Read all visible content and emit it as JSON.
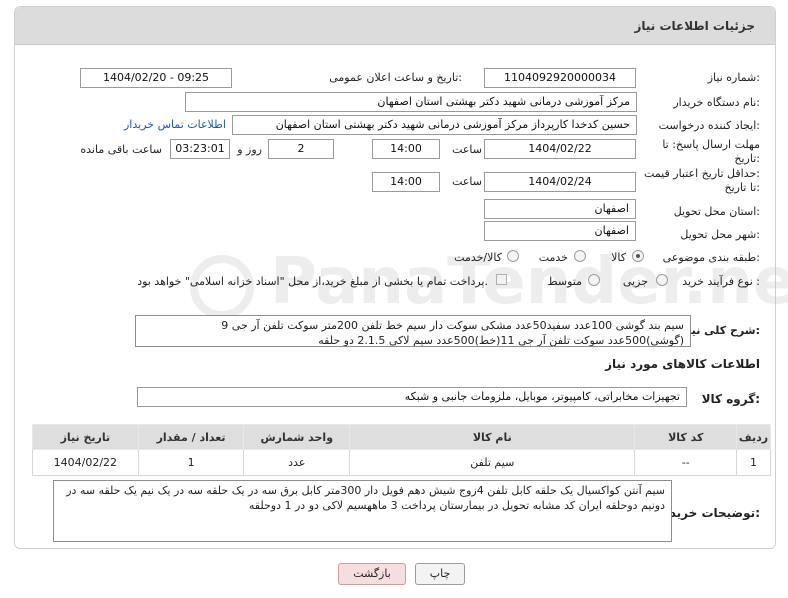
{
  "panel": {
    "title": "جزئیات اطلاعات نیاز"
  },
  "watermark": {
    "text": "PanaTender.net"
  },
  "need": {
    "number_label": "شماره نیاز:",
    "number": "1104092920000034",
    "announce_label": "تاریخ و ساعت اعلان عمومی:",
    "announce": "1404/02/20 - 09:25",
    "buyer_label": "نام دستگاه خریدار:",
    "buyer": "مرکز آموزشی درمانی شهید دکتر بهشتی استان اصفهان",
    "creator_label": "ایجاد کننده درخواست:",
    "creator": "حسین کدخدا کارپرداز مرکز آموزشی درمانی شهید دکتر بهشتی استان اصفهان",
    "contact_link": "اطلاعات تماس خریدار",
    "reply_label_1": "مهلت ارسال پاسخ: تا",
    "reply_label_2": "تاریخ:",
    "reply_date": "1404/02/22",
    "time_label": "ساعت",
    "reply_time": "14:00",
    "days": "2",
    "days_label": "روز و",
    "remaining": "03:23:01",
    "remaining_label": "ساعت باقی مانده",
    "price_label_1": "حداقل تاریخ اعتبار قیمت:",
    "price_label_2": "تا تاریخ:",
    "price_date": "1404/02/24",
    "price_time": "14:00",
    "province_label": "استان محل تحویل:",
    "province": "اصفهان",
    "city_label": "شهر محل تحویل:",
    "city": "اصفهان",
    "category_label": "طبقه بندی موضوعی:",
    "cat_goods": "کالا",
    "cat_service": "خدمت",
    "cat_both": "کالا/خدمت",
    "process_label": "نوع فرآیند خرید :",
    "proc_partial": "جزیی",
    "proc_medium": "متوسط",
    "payment_note": "پرداخت تمام یا بخشی از مبلغ خرید،از محل \"اسناد خزانه اسلامی\" خواهد بود."
  },
  "description": {
    "label": "شرح کلی نیاز:",
    "text": "سیم بند گوشی 100عدد سفید50عدد مشکی سوکت دار سیم خط تلفن 200متر سوکت تلفن آر جی 9 (گوشی)500عدد سوکت تلفن آر جی 11(خط)500عدد سیم لاکی 2.1.5 دو حلقه"
  },
  "goods": {
    "section_title": "اطلاعات کالاهای مورد نیاز",
    "group_label": "گروه کالا:",
    "group": "تجهیزات مخابراتی، کامپیوتر، موبایل، ملزومات جانبی و شبکه",
    "headers": [
      "ردیف",
      "کد کالا",
      "نام کالا",
      "واحد شمارش",
      "تعداد / مقدار",
      "تاریخ نیاز"
    ],
    "rows": [
      [
        "1",
        "--",
        "سیم تلفن",
        "عدد",
        "1",
        "1404/02/22"
      ]
    ]
  },
  "buyer_notes": {
    "label": "توضیحات خریدار:",
    "text": "سیم آنتن کواکسیال یک حلقه کابل تلفن 4زوج شیش دهم فویل دار 300متر کابل برق سه در یک حلقه سه در یک نیم یک حلقه سه در دونیم دوحلقه ایران کد مشابه تحویل در بیمارستان پرداخت 3 ماههسیم لاکی دو در 1 دوحلقه"
  },
  "buttons": {
    "print": "چاپ",
    "back": "بازگشت"
  },
  "colors": {
    "link": "#1a57b7",
    "header_bg": "#dcdcdc",
    "back_btn": "#f6dede"
  }
}
